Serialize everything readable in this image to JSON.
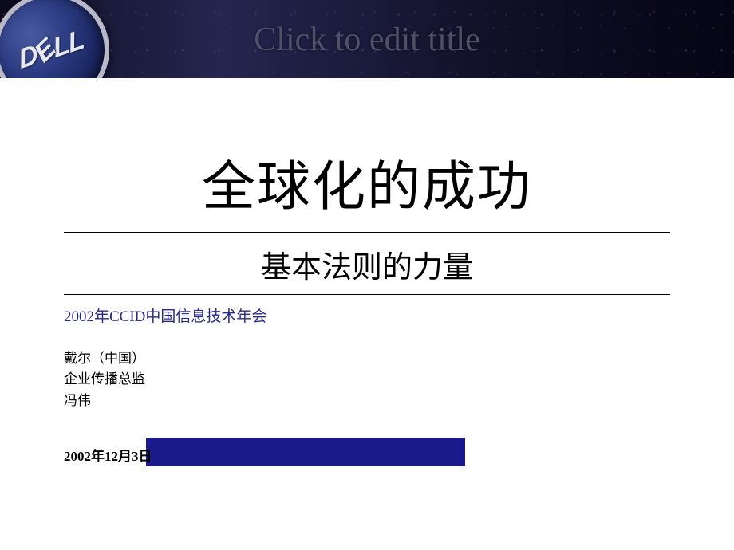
{
  "header": {
    "logo_text": "DELL",
    "placeholder_title": "Click to edit title"
  },
  "slide": {
    "main_title": "全球化的成功",
    "subtitle": "基本法则的力量",
    "event": "2002年CCID中国信息技术年会",
    "author": {
      "company": "戴尔（中国）",
      "position": "企业传播总监",
      "name": "冯伟"
    },
    "date": "2002年12月3日"
  }
}
